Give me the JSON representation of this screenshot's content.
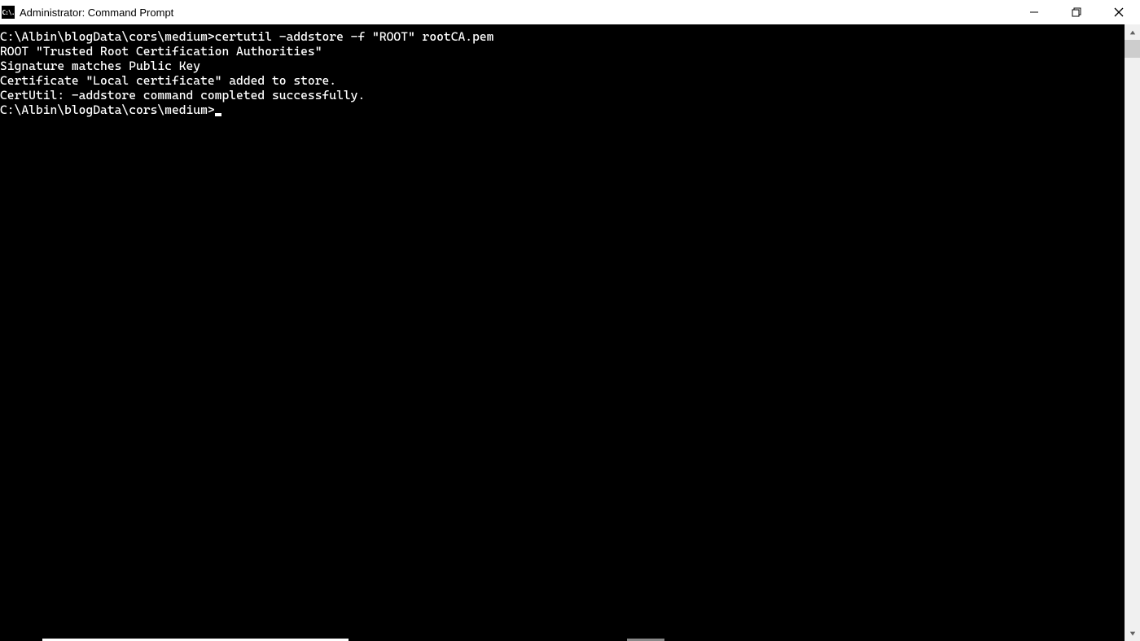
{
  "window": {
    "title": "Administrator: Command Prompt",
    "icon_text": "C:\\."
  },
  "terminal": {
    "lines": [
      "C:\\Albin\\blogData\\cors\\medium>certutil -addstore -f \"ROOT\" rootCA.pem",
      "ROOT \"Trusted Root Certification Authorities\"",
      "Signature matches Public Key",
      "Certificate \"Local certificate\" added to store.",
      "CertUtil: -addstore command completed successfully.",
      "",
      "C:\\Albin\\blogData\\cors\\medium>"
    ]
  }
}
